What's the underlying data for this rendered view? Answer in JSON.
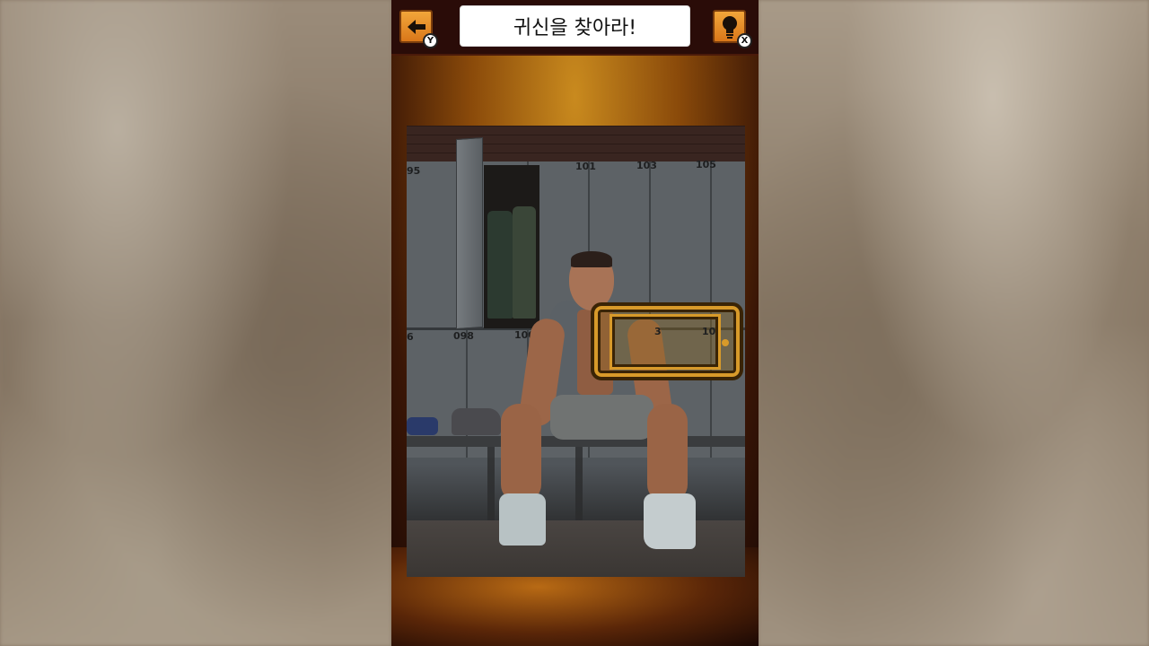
{
  "header": {
    "title": "귀신을 찾아라!",
    "back_badge": "Y",
    "hint_badge": "X"
  },
  "scene": {
    "locker_numbers": [
      "95",
      "101",
      "103",
      "105",
      "098",
      "100",
      "6",
      "3",
      "10"
    ]
  },
  "colors": {
    "accent_orange": "#e68a22",
    "frame_gold": "#d89a2a",
    "topbar": "#2a0c08"
  },
  "icons": {
    "back": "arrow-left-icon",
    "hint": "lightbulb-icon"
  }
}
